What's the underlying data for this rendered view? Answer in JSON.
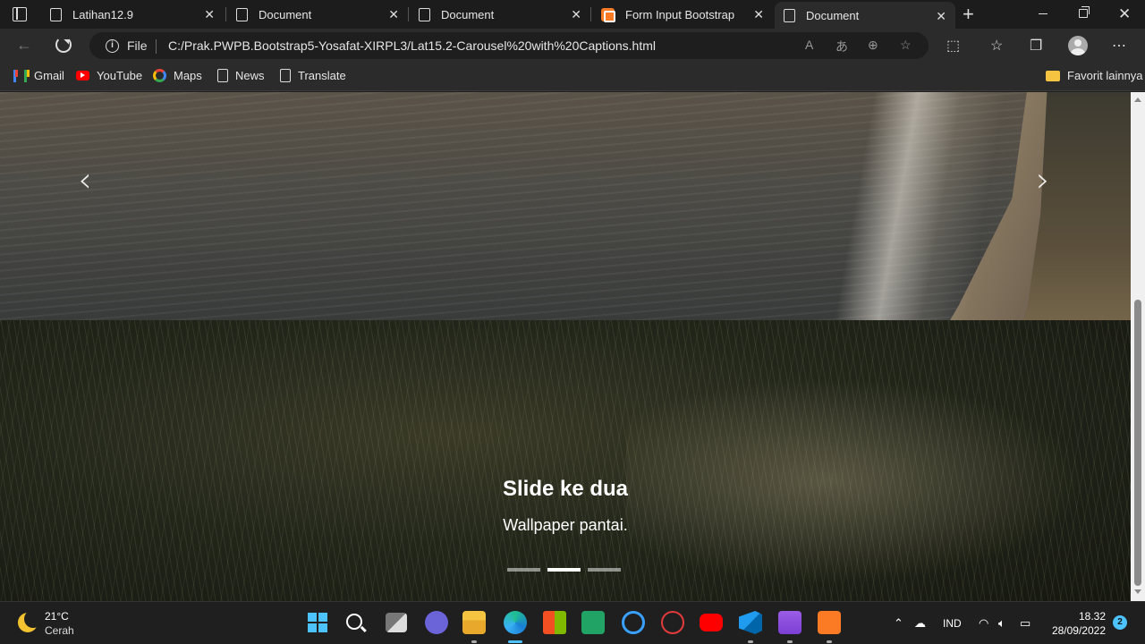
{
  "browser": {
    "tabs": [
      {
        "title": "Latihan12.9",
        "icon": "page-icon",
        "active": false
      },
      {
        "title": "Document",
        "icon": "page-icon",
        "active": false
      },
      {
        "title": "Document",
        "icon": "page-icon",
        "active": false
      },
      {
        "title": "Form Input Bootstrap",
        "icon": "xampp-icon",
        "active": false
      },
      {
        "title": "Document",
        "icon": "page-icon",
        "active": true
      }
    ],
    "tab_close": "✕",
    "new_tab": "+",
    "address": {
      "scheme_label": "File",
      "url": "C:/Prak.PWPB.Bootstrap5-Yosafat-XIRPL3/Lat15.2-Carousel%20with%20Captions.html"
    },
    "favorites": [
      {
        "label": "Gmail",
        "icon": "gmail-icon"
      },
      {
        "label": "YouTube",
        "icon": "youtube-icon"
      },
      {
        "label": "Maps",
        "icon": "maps-icon"
      },
      {
        "label": "News",
        "icon": "page-icon"
      },
      {
        "label": "Translate",
        "icon": "page-icon"
      }
    ],
    "other_favorites": "Favorit lainnya"
  },
  "carousel": {
    "caption_title": "Slide ke dua",
    "caption_text": "Wallpaper pantai.",
    "prev_glyph": "‹",
    "next_glyph": "›",
    "slide_count": 3,
    "active_index": 1
  },
  "taskbar": {
    "temperature": "21°C",
    "condition": "Cerah",
    "language": "IND",
    "time": "18.32",
    "date": "28/09/2022",
    "notifications": "2"
  },
  "colors": {
    "accent": "#4cc2ff",
    "browser_bg": "#2b2b2b",
    "taskbar_bg": "#1f1f1f"
  }
}
